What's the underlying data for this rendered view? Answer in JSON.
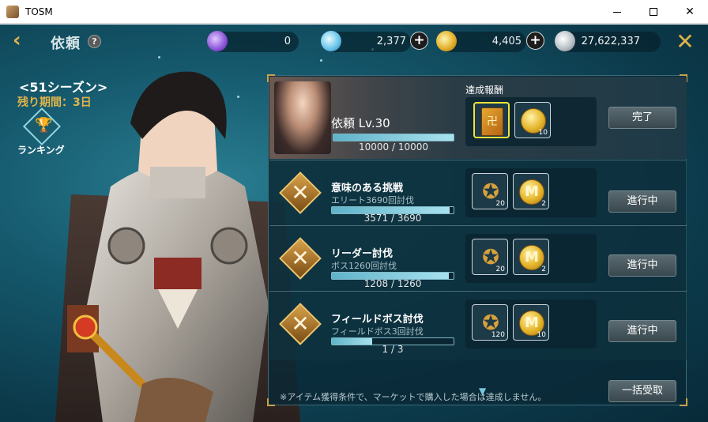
{
  "window": {
    "title": "TOSM"
  },
  "topbar": {
    "title": "依頼",
    "currencies": [
      {
        "icon": "purple-crystal-icon",
        "value": "0",
        "has_plus": false
      },
      {
        "icon": "blue-gem-icon",
        "value": "2,377",
        "has_plus": true
      },
      {
        "icon": "gold-coin-icon",
        "value": "4,405",
        "has_plus": true
      },
      {
        "icon": "silver-coin-icon",
        "value": "27,622,337",
        "has_plus": false
      }
    ]
  },
  "season": {
    "title": "<51シーズン>",
    "remaining": "残り期間：3日",
    "ranking_label": "ランキング"
  },
  "main_quest": {
    "name": "依頼 Lv.30",
    "progress_text": "10000 / 10000",
    "progress": 1.0,
    "rewards_label": "達成報酬",
    "rewards": [
      {
        "icon": "reward-book-icon",
        "glyph": "卍",
        "qty": "",
        "selected": true
      },
      {
        "icon": "gold-coin-icon",
        "glyph": "",
        "qty": "10",
        "selected": false
      }
    ],
    "button": "完了"
  },
  "quests": [
    {
      "title": "意味のある挑戦",
      "desc": "エリート3690回討伐",
      "progress_text": "3571 / 3690",
      "progress": 0.968,
      "rewards": [
        {
          "icon": "star-emblem-icon",
          "qty": "20"
        },
        {
          "icon": "m-coin-icon",
          "qty": "2"
        }
      ],
      "button": "進行中"
    },
    {
      "title": "リーダー討伐",
      "desc": "ボス1260回討伐",
      "progress_text": "1208 / 1260",
      "progress": 0.959,
      "rewards": [
        {
          "icon": "star-emblem-icon",
          "qty": "20"
        },
        {
          "icon": "m-coin-icon",
          "qty": "2"
        }
      ],
      "button": "進行中"
    },
    {
      "title": "フィールドボス討伐",
      "desc": "フィールドボス3回討伐",
      "progress_text": "1 / 3",
      "progress": 0.333,
      "rewards": [
        {
          "icon": "star-emblem-icon",
          "qty": "120"
        },
        {
          "icon": "m-coin-icon",
          "qty": "10"
        }
      ],
      "button": "進行中"
    }
  ],
  "footer": {
    "note": "※アイテム獲得条件で、マーケットで購入した場合は達成しません。",
    "bulk_button": "一括受取"
  },
  "colors": {
    "accent_gold": "#e0b44a",
    "bg_teal": "#15586c"
  }
}
